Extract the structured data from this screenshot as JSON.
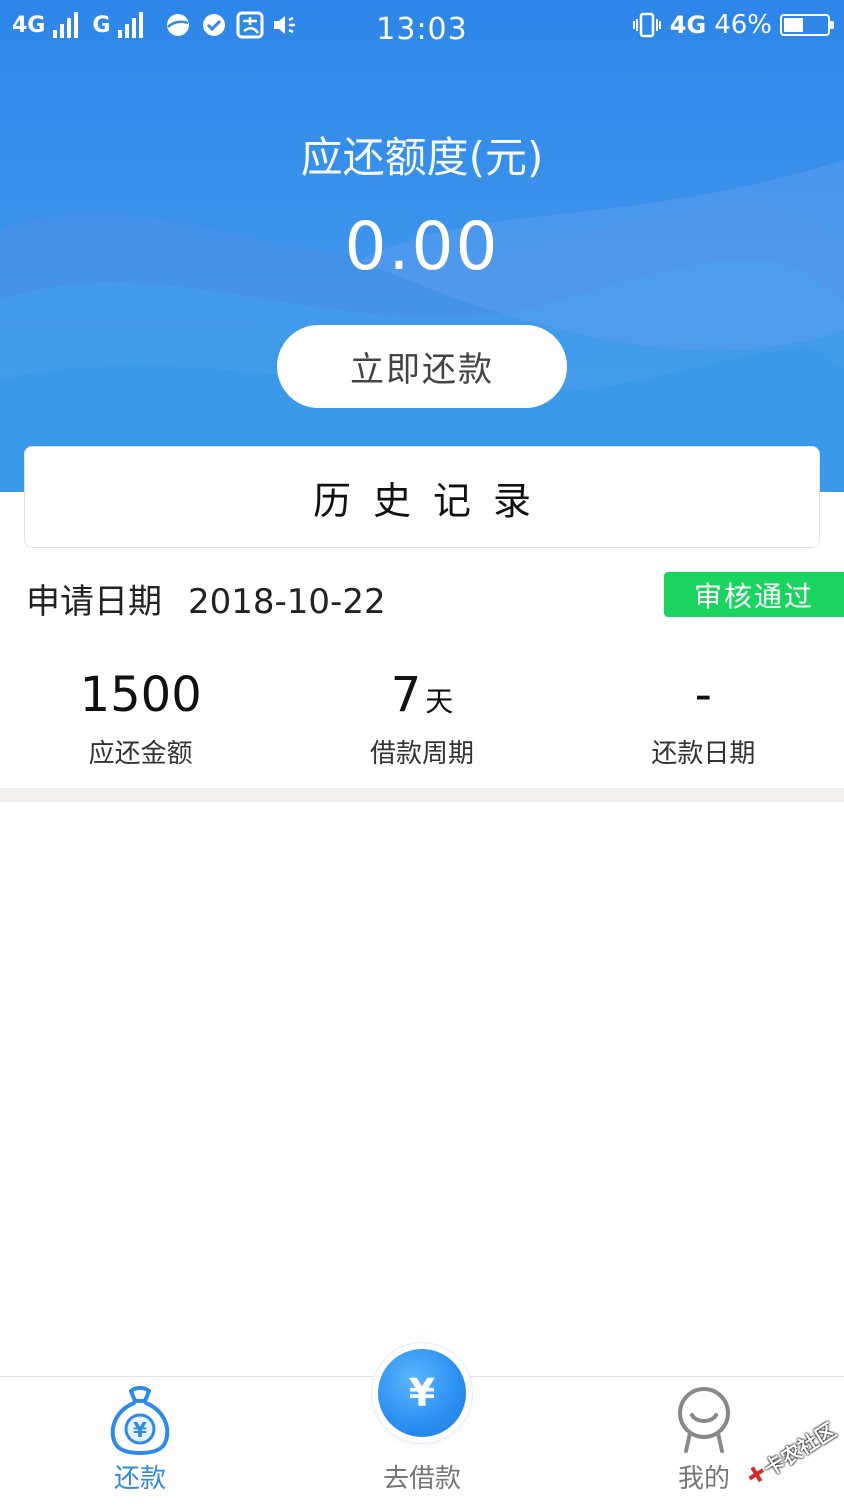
{
  "status_bar": {
    "network1": "4G",
    "network2": "G",
    "time": "13:03",
    "network_right": "4G",
    "battery": "46%",
    "battery_level": 0.46
  },
  "header": {
    "amount_label": "应还额度(元)",
    "amount_value": "0.00",
    "repay_button": "立即还款"
  },
  "history": {
    "title": "历史记录"
  },
  "record": {
    "apply_label": "申请日期",
    "apply_date": "2018-10-22",
    "status": "审核通过",
    "stats": [
      {
        "value": "1500",
        "unit": "",
        "label": "应还金额"
      },
      {
        "value": "7",
        "unit": "天",
        "label": "借款周期"
      },
      {
        "value": "-",
        "unit": "",
        "label": "还款日期"
      }
    ]
  },
  "tabbar": {
    "repay": "还款",
    "borrow": "去借款",
    "borrow_icon": "¥",
    "mine": "我的"
  },
  "watermark": {
    "text": "卡农社区"
  },
  "colors": {
    "header_blue": "#2d86e8",
    "status_green": "#19d45e",
    "tab_active": "#2f8ae6",
    "tab_inactive": "#777777"
  }
}
